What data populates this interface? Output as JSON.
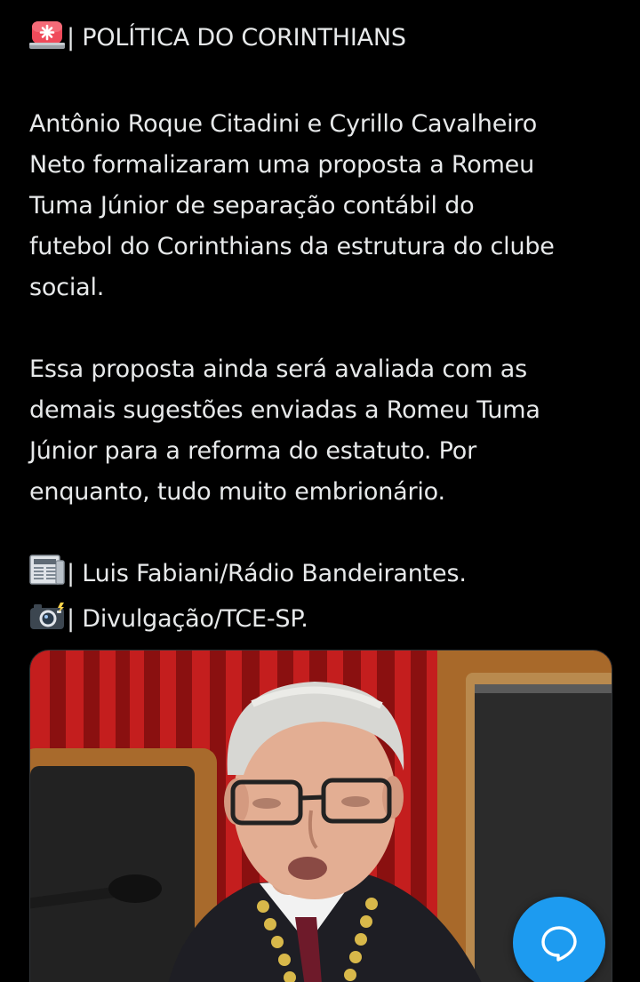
{
  "post": {
    "header": "| POLÍTICA DO CORINTHIANS",
    "paragraph1": [
      "Antônio Roque Citadini e Cyrillo Cavalheiro",
      "Neto formalizaram uma proposta a Romeu",
      "Tuma Júnior de separação contábil do",
      "futebol do Corinthians da estrutura do clube",
      "social."
    ],
    "paragraph2": [
      "Essa proposta ainda será avaliada com as",
      "demais sugestões enviadas a Romeu Tuma",
      "Júnior para a reforma do estatuto. Por",
      "enquanto, tudo muito embrionário."
    ],
    "credit_source": "| Luis Fabiani/Rádio Bandeirantes.",
    "credit_photo": "| Divulgação/TCE-SP."
  },
  "icons": {
    "header": "rotating-light-icon",
    "source": "newspaper-icon",
    "photo": "camera-flash-icon",
    "fab": "speech-bubble-icon"
  },
  "colors": {
    "background": "#000000",
    "text": "#e7e9ea",
    "accent": "#1d9bf0"
  }
}
